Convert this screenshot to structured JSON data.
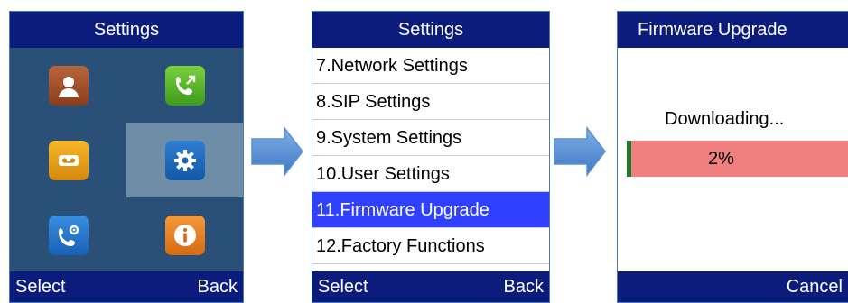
{
  "screen1": {
    "title": "Settings",
    "icons": [
      "contacts-icon",
      "call-history-icon",
      "voicemail-icon",
      "settings-gear-icon",
      "call-settings-icon",
      "info-icon"
    ],
    "selected_icon": "settings-gear-icon",
    "softkeys": {
      "left": "Select",
      "right": "Back"
    }
  },
  "screen2": {
    "title": "Settings",
    "items": [
      "7.Network Settings",
      "8.SIP Settings",
      "9.System Settings",
      "10.User Settings",
      "11.Firmware Upgrade",
      "12.Factory Functions"
    ],
    "selected_index": 4,
    "softkeys": {
      "left": "Select",
      "right": "Back"
    }
  },
  "screen3": {
    "title": "Firmware Upgrade",
    "status": "Downloading...",
    "progress_label": "2%",
    "progress": 0.02,
    "softkey_right": "Cancel"
  },
  "colors": {
    "titlebar": "#0b1c7d",
    "selection": "#2f40ff",
    "progress_bg": "#f08080",
    "progress_fill": "#1c7a2c",
    "arrow": "#5b8fd0"
  }
}
